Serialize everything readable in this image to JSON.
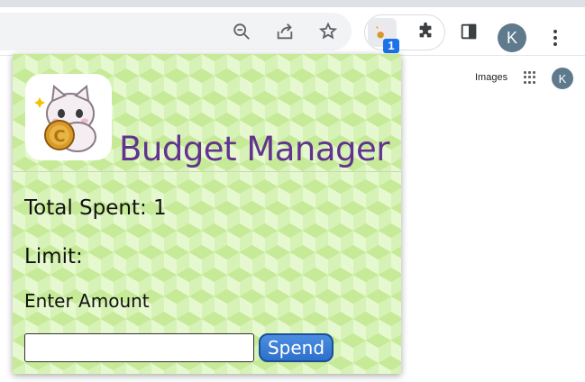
{
  "toolbar": {
    "icons": [
      "zoom-out-icon",
      "share-icon",
      "bookmark-star-icon",
      "extension-budget-icon",
      "extensions-puzzle-icon",
      "side-panel-icon"
    ],
    "extension_badge": "1",
    "profile_initial": "K"
  },
  "page": {
    "images_link": "Images",
    "profile_initial": "K"
  },
  "popup": {
    "title": "Budget Manager",
    "total_spent_label": "Total Spent: 1",
    "limit_label": "Limit:",
    "enter_amount_label": "Enter Amount",
    "amount_value": "",
    "spend_button": "Spend",
    "title_color": "#62338f",
    "button_color": "#3a7bd5"
  }
}
